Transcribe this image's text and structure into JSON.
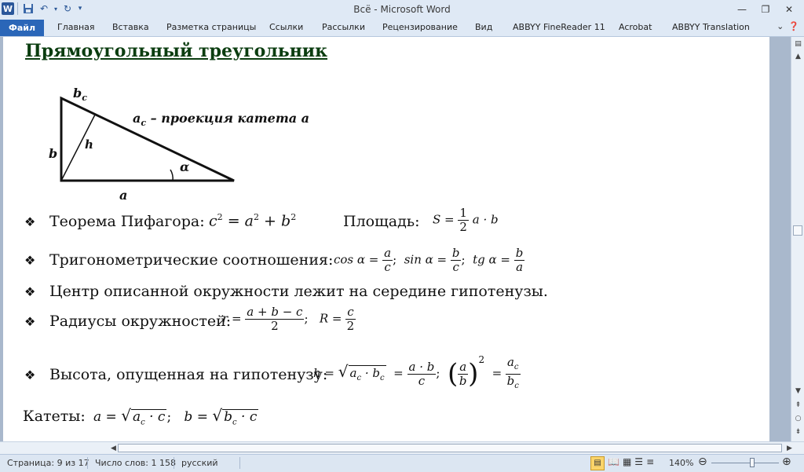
{
  "titlebar": {
    "title": "Всё  -  Microsoft Word",
    "app_icon": "W"
  },
  "ribbon": {
    "file_tab": "Файл",
    "tabs": [
      "Главная",
      "Вставка",
      "Разметка страницы",
      "Ссылки",
      "Рассылки",
      "Рецензирование",
      "Вид",
      "ABBYY FineReader 11",
      "Acrobat",
      "ABBYY Translation"
    ]
  },
  "document": {
    "heading": "Прямоугольный треугольник",
    "diagram": {
      "bc": "b",
      "bc_sub": "c",
      "ac": "a",
      "ac_sub": "c",
      "ac_text": " – проекция катета a",
      "h": "h",
      "b": "b",
      "a": "a",
      "alpha": "α"
    },
    "pythagoras_label": "Теорема Пифагора:",
    "pythagoras_formula": {
      "c": "c",
      "a": "a",
      "b": "b",
      "exp": "2"
    },
    "area_label": "Площадь:",
    "area_formula": {
      "lhs": "S =",
      "num": "1",
      "den": "2",
      "rhs": "a · b"
    },
    "trig_label": "Тригонометрические соотношения:",
    "trig": {
      "cos_lhs": "cos α =",
      "cos_num": "a",
      "cos_den": "c",
      "sin_lhs": "sin α =",
      "sin_num": "b",
      "sin_den": "c",
      "tg_lhs": "tg α =",
      "tg_num": "b",
      "tg_den": "a"
    },
    "circumcircle": "Центр описанной окружности лежит на середине гипотенузы.",
    "radii_label": "Радиусы окружностей:",
    "radii": {
      "r_lhs": "r =",
      "r_num": "a + b − c",
      "r_den": "2",
      "R_lhs": "R =",
      "R_num": "c",
      "R_den": "2"
    },
    "height_label": "Высота, опущенная на гипотенузу:",
    "height": {
      "lhs": "h =",
      "rad": "a",
      "rad_sub": "c",
      "rad2": "b",
      "rad2_sub": "c",
      "eq1_num": "a · b",
      "eq1_den": "c",
      "p_num": "a",
      "p_den": "b",
      "exp": "2",
      "q_num": "a",
      "q_num_sub": "c",
      "q_den": "b",
      "q_den_sub": "c"
    },
    "legs_label": "Катеты:",
    "legs": {
      "a_lhs": "a =",
      "a_rad": "a",
      "a_sub": "c",
      "a_rad2": "c",
      "b_lhs": "b =",
      "b_rad": "b",
      "b_sub": "c",
      "b_rad2": "c"
    }
  },
  "status": {
    "page": "Страница: 9 из 17",
    "words": "Число слов: 1 158",
    "lang": "русский",
    "zoom": "140%"
  }
}
